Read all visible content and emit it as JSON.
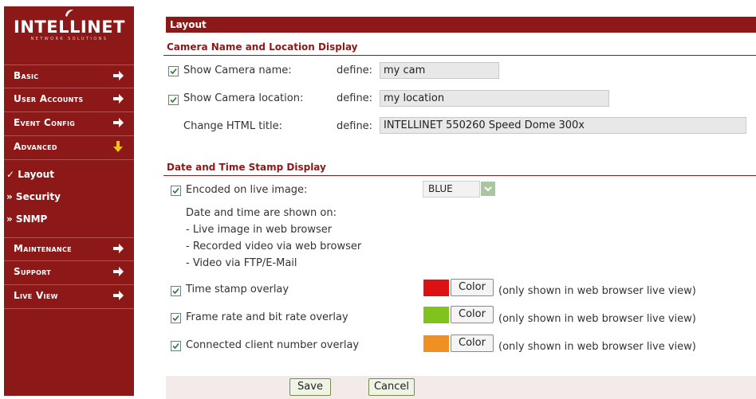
{
  "brand": {
    "name": "INTELLINET",
    "tagline": "NETWORK SOLUTIONS"
  },
  "colors": {
    "brand": "#8d1818",
    "red_swatch": "#dd1111",
    "green_swatch": "#7fc31c",
    "orange_swatch": "#f19022"
  },
  "sidebar": {
    "items": [
      {
        "label": "Basic",
        "icon": "arrow-right-icon"
      },
      {
        "label": "User Accounts",
        "icon": "arrow-right-icon"
      },
      {
        "label": "Event Config",
        "icon": "arrow-right-icon"
      },
      {
        "label": "Advanced",
        "icon": "arrow-down-icon"
      }
    ],
    "sub_items": [
      {
        "label": "✓ Layout"
      },
      {
        "label": "» Security"
      },
      {
        "label": "» SNMP"
      }
    ],
    "items_bottom": [
      {
        "label": "Maintenance",
        "icon": "arrow-right-icon"
      },
      {
        "label": "Support",
        "icon": "arrow-right-icon"
      },
      {
        "label": "Live View",
        "icon": "arrow-right-icon"
      }
    ]
  },
  "main": {
    "title": "Layout",
    "camera_section": {
      "heading": "Camera Name and Location Display",
      "rows": [
        {
          "label": "Show Camera name:",
          "checked": true,
          "define": "define:",
          "value": "my cam"
        },
        {
          "label": "Show Camera location:",
          "checked": true,
          "define": "define:",
          "value": "my location"
        },
        {
          "label": "Change HTML title:",
          "checked": false,
          "define": "define:",
          "value": "INTELLINET 550260 Speed Dome 300x"
        }
      ]
    },
    "date_section": {
      "heading": "Date and Time Stamp Display",
      "encoded_label": "Encoded on live image:",
      "encoded_checked": true,
      "encoded_color": "BLUE",
      "info_lines": [
        "Date and time are shown on:",
        "- Live image in web browser",
        "- Recorded video via web browser",
        "- Video via FTP/E-Mail"
      ],
      "overlays": [
        {
          "label": "Time stamp overlay",
          "checked": true,
          "button": "Color",
          "note": "(only shown in web browser live view)"
        },
        {
          "label": "Frame rate and bit rate overlay",
          "checked": true,
          "button": "Color",
          "note": "(only shown in web browser live view)"
        },
        {
          "label": "Connected client number overlay",
          "checked": true,
          "button": "Color",
          "note": "(only shown in web browser live view)"
        }
      ]
    },
    "buttons": {
      "save": "Save",
      "cancel": "Cancel"
    }
  }
}
